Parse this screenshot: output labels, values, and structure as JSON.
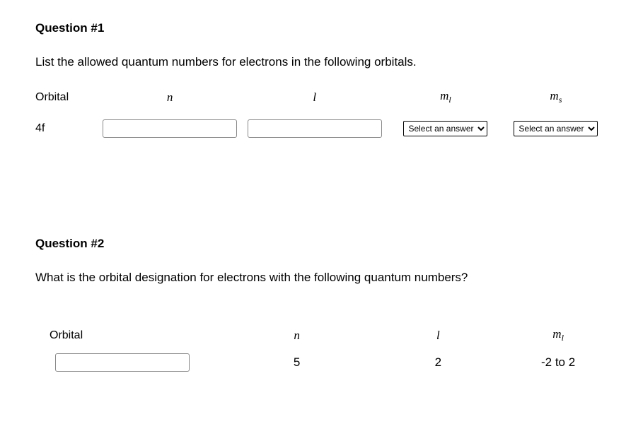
{
  "q1": {
    "title": "Question #1",
    "text": "List the allowed quantum numbers for electrons in the following orbitals.",
    "headers": {
      "orbital": "Orbital",
      "n": "n",
      "l": "l",
      "ml_m": "m",
      "ml_sub": "l",
      "ms_m": "m",
      "ms_sub": "s"
    },
    "row": {
      "orbital": "4f",
      "n": "",
      "l": "",
      "ml_selected": "Select an answer",
      "ms_selected": "Select an answer"
    }
  },
  "q2": {
    "title": "Question #2",
    "text": "What is the orbital designation for electrons with the following quantum numbers?",
    "headers": {
      "orbital": "Orbital",
      "n": "n",
      "l": "l",
      "ml_m": "m",
      "ml_sub": "l"
    },
    "row": {
      "orbital": "",
      "n": "5",
      "l": "2",
      "ml": "-2 to 2"
    }
  }
}
